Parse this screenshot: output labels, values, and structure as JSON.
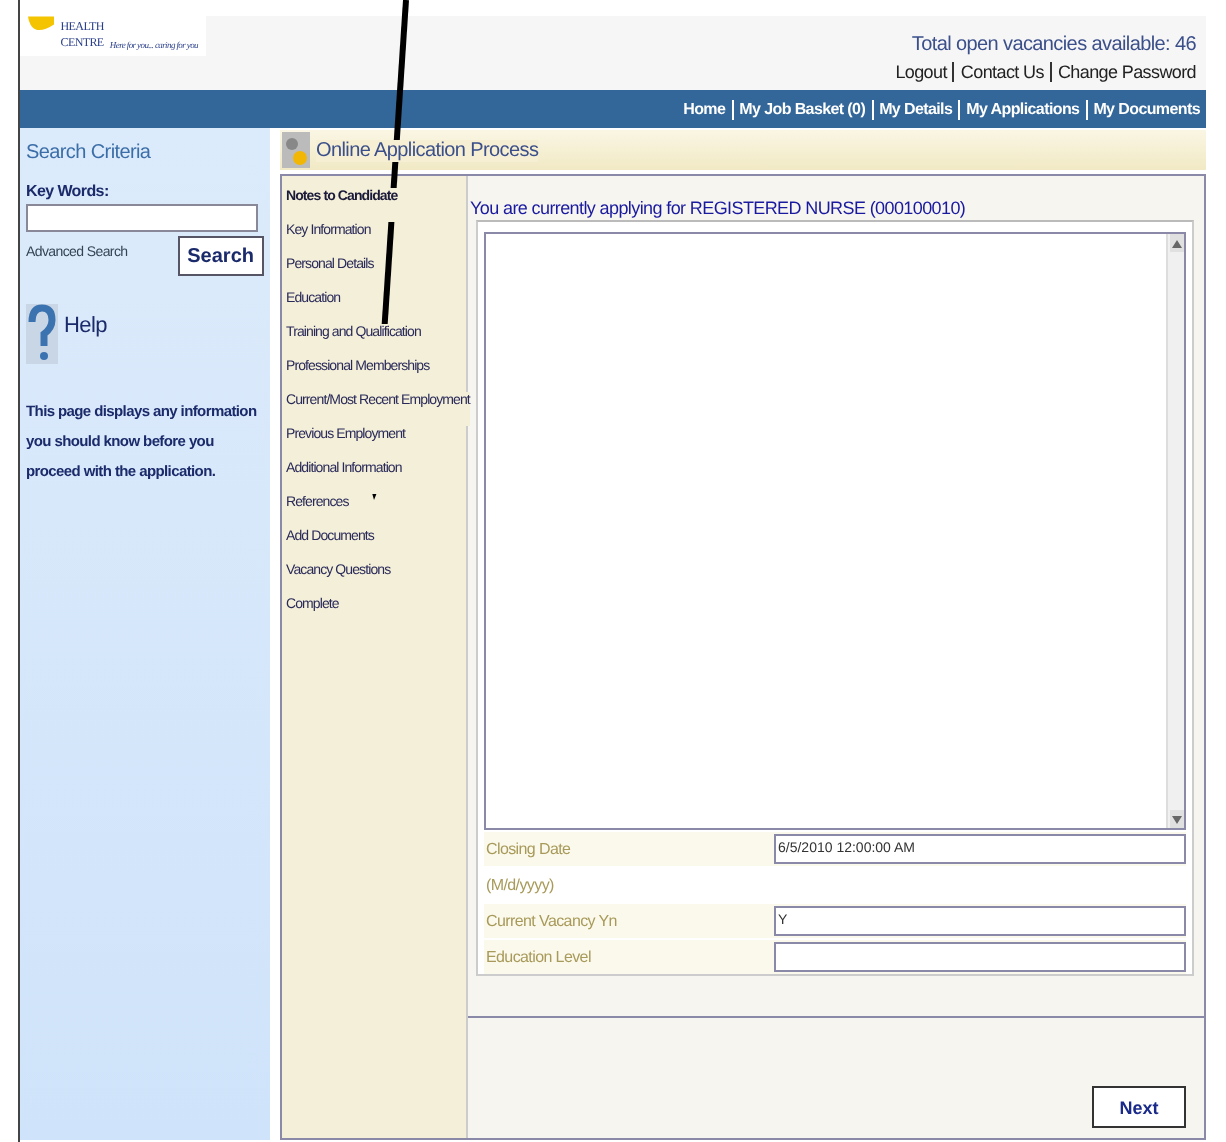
{
  "header": {
    "logo_lines": [
      "HEALTH",
      "CENTRE"
    ],
    "tagline": "Here for you... caring for you",
    "vacancies": "Total open vacancies available: 46",
    "top_links": [
      "Logout",
      "Contact Us",
      "Change Password"
    ]
  },
  "nav": [
    "Home",
    "My Job Basket (0)",
    "My Details",
    "My Applications",
    "My Documents"
  ],
  "sidebar": {
    "title": "Search Criteria",
    "keywords_label": "Key Words:",
    "advanced_link": "Advanced Search",
    "search_button": "Search",
    "help_title": "Help",
    "help_text": "This page displays any information you should know before you proceed with the application."
  },
  "process": {
    "title": "Online Application Process",
    "steps": [
      {
        "label": "Notes to Candidate",
        "selected": true
      },
      {
        "label": "Key Information",
        "selected": false
      },
      {
        "label": "Personal Details",
        "selected": false
      },
      {
        "label": "Education",
        "selected": false
      },
      {
        "label": "Training and Qualification",
        "selected": false
      },
      {
        "label": "Professional Memberships",
        "selected": false
      },
      {
        "label": "Current/Most Recent Employment",
        "selected": false
      },
      {
        "label": "Previous Employment",
        "selected": false
      },
      {
        "label": "Additional Information",
        "selected": false
      },
      {
        "label": "References",
        "selected": false
      },
      {
        "label": "Add Documents",
        "selected": false
      },
      {
        "label": "Vacancy Questions",
        "selected": false
      },
      {
        "label": "Complete",
        "selected": false
      }
    ],
    "applying": "You are currently applying for REGISTERED NURSE (000100010)",
    "fields": [
      {
        "kind": "field",
        "label": "Closing Date",
        "value": "6/5/2010 12:00:00 AM"
      },
      {
        "kind": "hint",
        "label": "(M/d/yyyy)"
      },
      {
        "kind": "field",
        "label": "Current Vacancy Yn",
        "value": "Y"
      },
      {
        "kind": "field",
        "label": "Education Level"
      }
    ],
    "next_button": "Next"
  }
}
